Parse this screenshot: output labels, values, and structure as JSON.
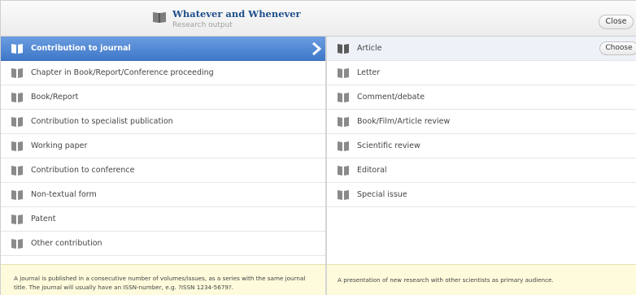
{
  "header": {
    "title": "Whatever and Whenever",
    "subtitle": "Research output",
    "close_label": "Close",
    "icon": "book-icon"
  },
  "left_list": {
    "items": [
      {
        "label": "Contribution to journal",
        "selected": true
      },
      {
        "label": "Chapter in Book/Report/Conference proceeding"
      },
      {
        "label": "Book/Report"
      },
      {
        "label": "Contribution to specialist publication"
      },
      {
        "label": "Working paper"
      },
      {
        "label": "Contribution to conference"
      },
      {
        "label": "Non-textual form"
      },
      {
        "label": "Patent"
      },
      {
        "label": "Other contribution"
      }
    ],
    "description": "A journal is published in a consecutive number of volumes/issues, as a series with the same journal title. The journal will usually have an ISSN-number, e.g. ?ISSN 1234-5679?."
  },
  "right_list": {
    "items": [
      {
        "label": "Article",
        "highlighted": true
      },
      {
        "label": "Letter"
      },
      {
        "label": "Comment/debate"
      },
      {
        "label": "Book/Film/Article review"
      },
      {
        "label": "Scientific review"
      },
      {
        "label": "Editoral"
      },
      {
        "label": "Special issue"
      }
    ],
    "choose_label": "Choose",
    "description": "A presentation of new research with other scientists as primary audience."
  },
  "colors": {
    "selected": "#4a84d2",
    "description_bg": "#fdfbdc",
    "title": "#1f4f8c"
  }
}
